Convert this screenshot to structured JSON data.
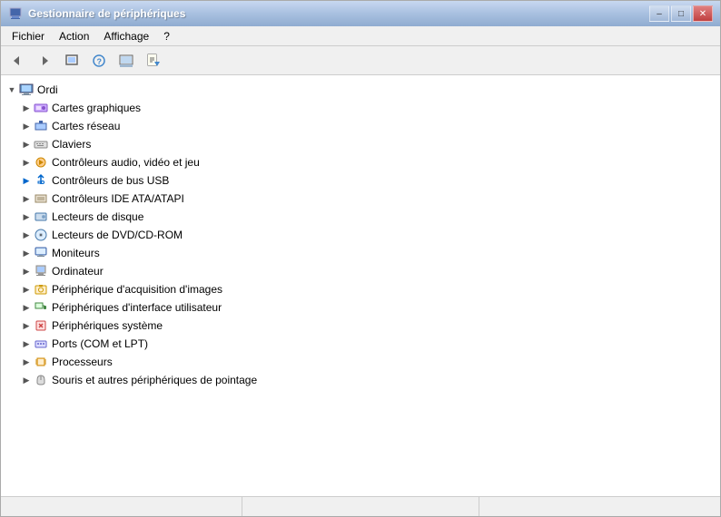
{
  "window": {
    "title": "Gestionnaire de périphériques",
    "controls": {
      "minimize": "–",
      "maximize": "□",
      "close": "✕"
    }
  },
  "menubar": {
    "items": [
      {
        "id": "fichier",
        "label": "Fichier"
      },
      {
        "id": "action",
        "label": "Action"
      },
      {
        "id": "affichage",
        "label": "Affichage"
      },
      {
        "id": "aide",
        "label": "?"
      }
    ]
  },
  "toolbar": {
    "buttons": [
      {
        "id": "back",
        "icon": "◀",
        "title": "Précédent"
      },
      {
        "id": "forward",
        "icon": "▶",
        "title": "Suivant"
      },
      {
        "id": "up",
        "icon": "⊡",
        "title": "Monter"
      },
      {
        "id": "help",
        "icon": "❓",
        "title": "Aide"
      },
      {
        "id": "view",
        "icon": "⊞",
        "title": "Afficher"
      },
      {
        "id": "properties",
        "icon": "⊟",
        "title": "Propriétés"
      }
    ]
  },
  "tree": {
    "root": {
      "label": "Ordi",
      "expanded": true,
      "children": [
        {
          "label": "Cartes graphiques",
          "icon": "🖥",
          "expanded": false,
          "indent": 1
        },
        {
          "label": "Cartes réseau",
          "icon": "🖧",
          "expanded": false,
          "indent": 1
        },
        {
          "label": "Claviers",
          "icon": "⌨",
          "expanded": false,
          "indent": 1
        },
        {
          "label": "Contrôleurs audio, vidéo et jeu",
          "icon": "🔊",
          "expanded": false,
          "indent": 1
        },
        {
          "label": "Contrôleurs de bus USB",
          "icon": "🔌",
          "expanded": false,
          "indent": 1,
          "hasChild": true
        },
        {
          "label": "Contrôleurs IDE ATA/ATAPI",
          "icon": "💾",
          "expanded": false,
          "indent": 1
        },
        {
          "label": "Lecteurs de disque",
          "icon": "💽",
          "expanded": false,
          "indent": 1
        },
        {
          "label": "Lecteurs de DVD/CD-ROM",
          "icon": "📀",
          "expanded": false,
          "indent": 1
        },
        {
          "label": "Moniteurs",
          "icon": "🖥",
          "expanded": false,
          "indent": 1
        },
        {
          "label": "Ordinateur",
          "icon": "🖥",
          "expanded": false,
          "indent": 1
        },
        {
          "label": "Périphérique d'acquisition d'images",
          "icon": "📷",
          "expanded": false,
          "indent": 1
        },
        {
          "label": "Périphériques d'interface utilisateur",
          "icon": "🖱",
          "expanded": false,
          "indent": 1
        },
        {
          "label": "Périphériques système",
          "icon": "⚙",
          "expanded": false,
          "indent": 1
        },
        {
          "label": "Ports (COM et LPT)",
          "icon": "🔌",
          "expanded": false,
          "indent": 1
        },
        {
          "label": "Processeurs",
          "icon": "🖥",
          "expanded": false,
          "indent": 1
        },
        {
          "label": "Souris et autres périphériques de pointage",
          "icon": "🖱",
          "expanded": false,
          "indent": 1
        }
      ]
    }
  },
  "statusbar": {
    "segments": [
      "",
      "",
      ""
    ]
  }
}
